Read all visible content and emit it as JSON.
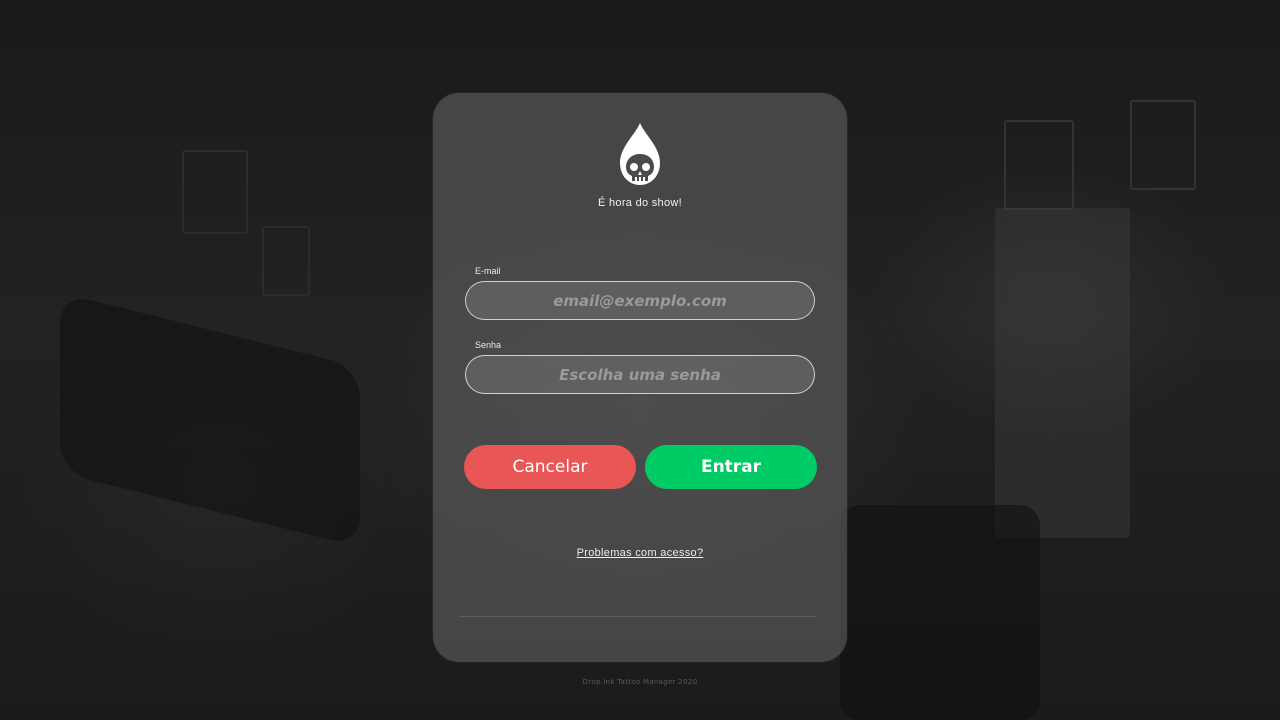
{
  "login": {
    "tagline": "É hora do show!",
    "email": {
      "label": "E-mail",
      "placeholder": "email@exemplo.com",
      "value": ""
    },
    "password": {
      "label": "Senha",
      "placeholder": "Escolha uma senha",
      "value": ""
    },
    "cancel_label": "Cancelar",
    "submit_label": "Entrar",
    "help_link": "Problemas com acesso?"
  },
  "footer": {
    "text": "Drop Ink Tattoo Manager 2020"
  },
  "colors": {
    "cancel": "#e85656",
    "submit": "#00cc66",
    "card": "#5f5f5f"
  },
  "icons": {
    "logo": "skull-drop-icon"
  }
}
